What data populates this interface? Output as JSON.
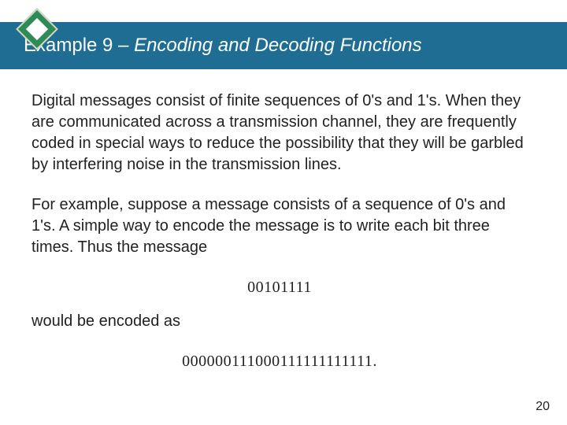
{
  "title": {
    "prefix": "Example 9 – ",
    "subtitle": "Encoding and Decoding Functions"
  },
  "body": {
    "para1": "Digital messages consist of finite sequences of 0's and 1's. When they are communicated across a transmission channel, they are frequently coded in special ways to reduce the possibility that they will be garbled by interfering noise in the transmission lines.",
    "para2": "For example, suppose a message consists of a sequence of 0's and 1's. A simple way to encode the message is to write each bit three times. Thus the message",
    "message": "00101111",
    "para3": "would be encoded as",
    "encoded": "000000111000111111111111."
  },
  "page_number": "20"
}
